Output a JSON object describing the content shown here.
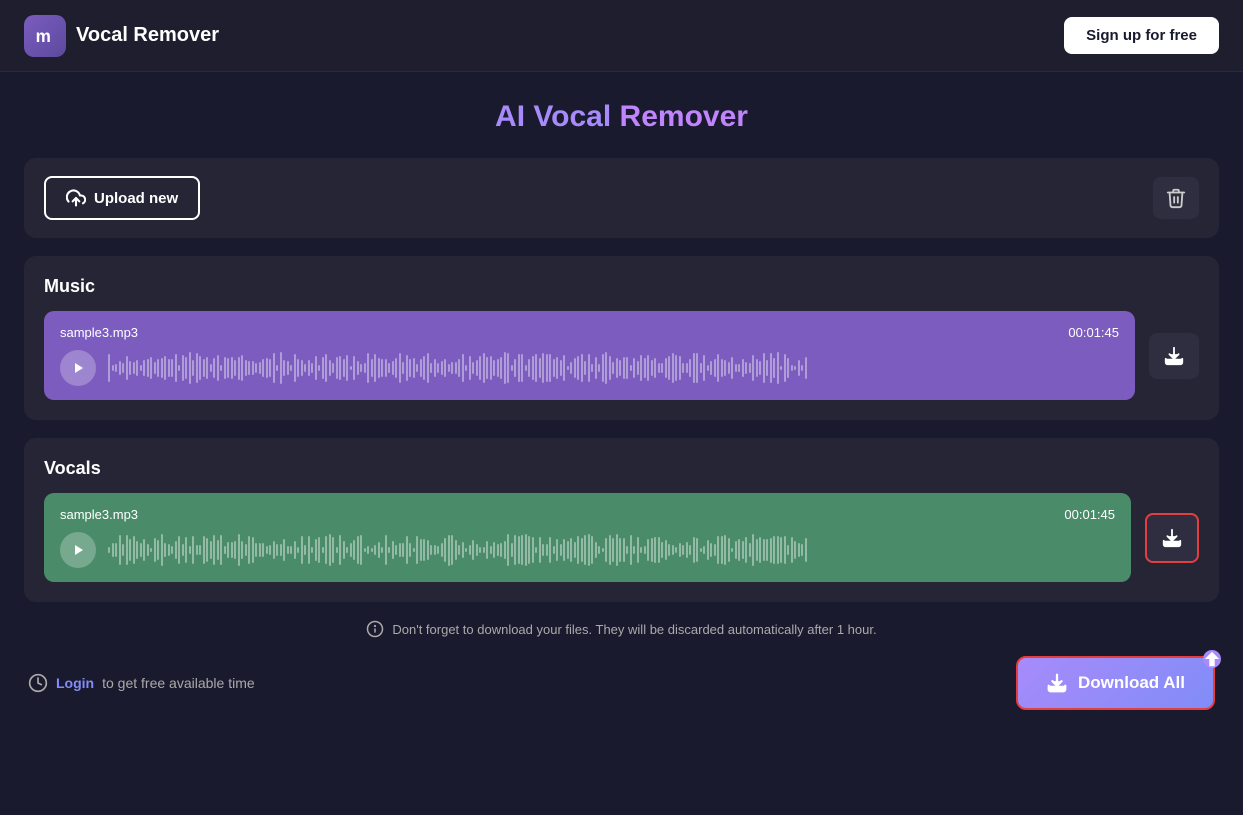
{
  "header": {
    "logo_letter": "m",
    "title": "Vocal Remover",
    "signup_label": "Sign up for free"
  },
  "page": {
    "title_part1": "AI Vocal",
    "title_part2": " Remover"
  },
  "upload": {
    "button_label": "Upload new"
  },
  "music_section": {
    "label": "Music",
    "filename": "sample3.mp3",
    "duration": "00:01:45"
  },
  "vocals_section": {
    "label": "Vocals",
    "filename": "sample3.mp3",
    "duration": "00:01:45"
  },
  "notice": {
    "text": "Don't forget to download your files. They will be discarded automatically after 1 hour."
  },
  "bottom": {
    "login_prefix": "",
    "login_label": "Login",
    "login_suffix": " to get free available time",
    "download_all_label": "Download All"
  }
}
